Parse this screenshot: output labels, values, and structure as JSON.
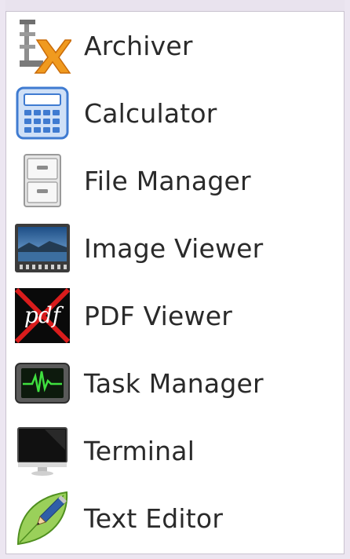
{
  "menu": {
    "items": [
      {
        "label": "Archiver",
        "icon": "archiver-icon"
      },
      {
        "label": "Calculator",
        "icon": "calculator-icon"
      },
      {
        "label": "File Manager",
        "icon": "file-cabinet-icon"
      },
      {
        "label": "Image Viewer",
        "icon": "landscape-picture-icon"
      },
      {
        "label": "PDF Viewer",
        "icon": "pdf-icon",
        "icon_text": "pdf"
      },
      {
        "label": "Task Manager",
        "icon": "heartbeat-monitor-icon"
      },
      {
        "label": "Terminal",
        "icon": "monitor-icon"
      },
      {
        "label": "Text Editor",
        "icon": "leaf-pencil-icon"
      }
    ]
  },
  "colors": {
    "background": "#ece6f1",
    "menu_bg": "#ffffff",
    "text": "#2a2a2a",
    "pdf_red": "#d91c1c"
  }
}
